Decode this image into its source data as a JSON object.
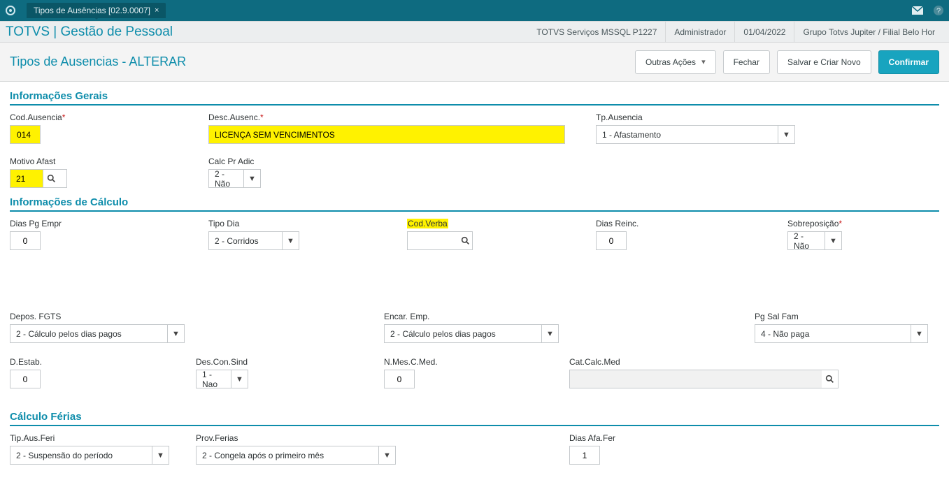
{
  "topbar": {
    "tabTitle": "Tipos de Ausências [02.9.0007]"
  },
  "header": {
    "brand": "TOTVS | Gestão de Pessoal",
    "env": "TOTVS Serviços MSSQL P1227",
    "user": "Administrador",
    "date": "01/04/2022",
    "branch": "Grupo Totvs Jupiter / Filial Belo Hor"
  },
  "action": {
    "pageTitle": "Tipos de Ausencias - ALTERAR",
    "otherActions": "Outras Ações",
    "close": "Fechar",
    "saveNew": "Salvar e Criar Novo",
    "confirm": "Confirmar"
  },
  "sections": {
    "general": "Informações Gerais",
    "calc": "Informações de Cálculo",
    "ferias": "Cálculo Férias"
  },
  "fields": {
    "codAusencia": {
      "label": "Cod.Ausencia",
      "value": "014"
    },
    "descAusenc": {
      "label": "Desc.Ausenc.",
      "value": "LICENÇA SEM VENCIMENTOS"
    },
    "tpAusencia": {
      "label": "Tp.Ausencia",
      "value": "1 - Afastamento"
    },
    "motivoAfast": {
      "label": "Motivo Afast",
      "value": "21"
    },
    "calcPrAdic": {
      "label": "Calc Pr Adic",
      "value": "2 - Não"
    },
    "diasPgEmpr": {
      "label": "Dias Pg Empr",
      "value": "0"
    },
    "tipoDia": {
      "label": "Tipo Dia",
      "value": "2 - Corridos"
    },
    "codVerba": {
      "label": "Cod.Verba",
      "value": ""
    },
    "diasReinc": {
      "label": "Dias Reinc.",
      "value": "0"
    },
    "sobreposicao": {
      "label": "Sobreposição",
      "value": "2 - Não"
    },
    "deposFGTS": {
      "label": "Depos. FGTS",
      "value": "2 - Cálculo pelos dias pagos"
    },
    "encarEmp": {
      "label": "Encar. Emp.",
      "value": "2 - Cálculo pelos dias pagos"
    },
    "pgSalFam": {
      "label": "Pg Sal Fam",
      "value": "4 - Não paga"
    },
    "dEstab": {
      "label": "D.Estab.",
      "value": "0"
    },
    "desConSind": {
      "label": "Des.Con.Sind",
      "value": "1 - Nao"
    },
    "nMesCMed": {
      "label": "N.Mes.C.Med.",
      "value": "0"
    },
    "catCalcMed": {
      "label": "Cat.Calc.Med",
      "value": ""
    },
    "tipAusFeri": {
      "label": "Tip.Aus.Feri",
      "value": "2 - Suspensão do período"
    },
    "provFerias": {
      "label": "Prov.Ferias",
      "value": "2 - Congela após o primeiro mês"
    },
    "diasAfaFer": {
      "label": "Dias Afa.Fer",
      "value": "1"
    }
  }
}
